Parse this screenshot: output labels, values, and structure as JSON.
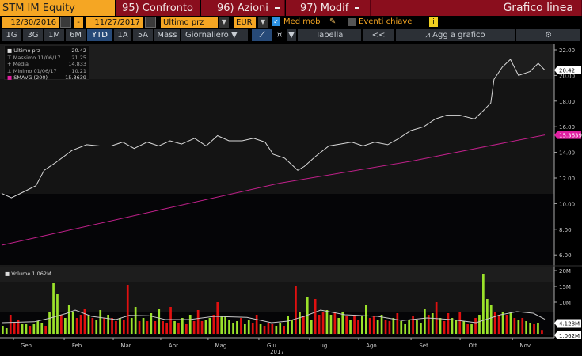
{
  "header": {
    "title": "STM IM Equity",
    "btn_compare": "95) Confronto",
    "btn_actions": "96) Azioni",
    "btn_edit": "97) Modif",
    "chart_type": "Grafico linea"
  },
  "controls": {
    "start_date": "12/30/2016",
    "date_sep": "-",
    "end_date": "11/27/2017",
    "price_field": "Ultimo prz",
    "currency": "EUR",
    "moving_avg_label": "Med mob",
    "key_events_label": "Eventi chiave",
    "info": "i"
  },
  "periods": [
    "1G",
    "3G",
    "1M",
    "6M",
    "YTD",
    "1A",
    "5A",
    "Mass"
  ],
  "frequency": "Giornaliero",
  "toolbar": {
    "table": "Tabella",
    "collapse": "<<",
    "add_to_chart": "Agg a grafico"
  },
  "legend": {
    "last": {
      "label": "Ultimo prz",
      "value": "20.42"
    },
    "high": {
      "label": "Massimo 11/06/17",
      "value": "21.25"
    },
    "avg": {
      "label": "Media",
      "value": "14.833"
    },
    "low": {
      "label": "Minimo 01/06/17",
      "value": "10.21"
    },
    "smavg": {
      "label": "SMAVG (200)",
      "value": "15.3639"
    },
    "volume": "Volume 1.062M"
  },
  "colors": {
    "price": "#d8d8d8",
    "smavg": "#c0208a",
    "up": "#9be22a",
    "down": "#e01010",
    "accent": "#f5a623",
    "header_red": "#8a0e1d"
  },
  "chart_data": [
    {
      "type": "line",
      "title": "STM IM Equity",
      "x_unit": "days since 12/30/2016",
      "xlim": [
        0,
        332
      ],
      "ylim": [
        5.5,
        22.5
      ],
      "yticks": [
        "22.00",
        "20.00",
        "18.00",
        "16.00",
        "14.00",
        "12.00",
        "10.00",
        "8.00",
        "6.00"
      ],
      "series": [
        {
          "name": "Ultimo prz",
          "points": [
            [
              0,
              10.8
            ],
            [
              6,
              10.45
            ],
            [
              14,
              10.95
            ],
            [
              21,
              11.4
            ],
            [
              26,
              12.6
            ],
            [
              33,
              13.2
            ],
            [
              43,
              14.15
            ],
            [
              52,
              14.6
            ],
            [
              60,
              14.5
            ],
            [
              67,
              14.5
            ],
            [
              74,
              14.8
            ],
            [
              81,
              14.3
            ],
            [
              89,
              14.8
            ],
            [
              96,
              14.5
            ],
            [
              103,
              14.9
            ],
            [
              110,
              14.65
            ],
            [
              118,
              15.1
            ],
            [
              125,
              14.5
            ],
            [
              132,
              15.3
            ],
            [
              139,
              14.9
            ],
            [
              147,
              14.9
            ],
            [
              154,
              15.1
            ],
            [
              161,
              14.8
            ],
            [
              166,
              13.85
            ],
            [
              173,
              13.55
            ],
            [
              181,
              12.6
            ],
            [
              185,
              12.9
            ],
            [
              192,
              13.7
            ],
            [
              200,
              14.5
            ],
            [
              207,
              14.65
            ],
            [
              214,
              14.8
            ],
            [
              221,
              14.5
            ],
            [
              228,
              14.8
            ],
            [
              236,
              14.6
            ],
            [
              243,
              15.1
            ],
            [
              250,
              15.7
            ],
            [
              258,
              16
            ],
            [
              265,
              16.6
            ],
            [
              272,
              16.9
            ],
            [
              280,
              16.9
            ],
            [
              289,
              16.6
            ],
            [
              294,
              17.2
            ],
            [
              299,
              17.85
            ],
            [
              301,
              19.7
            ],
            [
              306,
              20.65
            ],
            [
              311,
              21.25
            ],
            [
              316,
              20.0
            ],
            [
              323,
              20.3
            ],
            [
              328,
              20.95
            ],
            [
              332,
              20.42
            ]
          ],
          "last_tag": "20.42"
        },
        {
          "name": "SMAVG (200)",
          "points": [
            [
              0,
              6.75
            ],
            [
              100,
              9.6
            ],
            [
              170,
              11.6
            ],
            [
              250,
              13.3
            ],
            [
              332,
              15.36
            ]
          ],
          "last_tag": "15.3639"
        }
      ]
    },
    {
      "type": "bar",
      "title": "Volume",
      "unit": "M",
      "note": "negative = down day (red), positive = up day (green)",
      "ylim": [
        0,
        20
      ],
      "yticks": [
        "20M",
        "15M",
        "10M"
      ],
      "values": [
        2.5,
        2,
        -6,
        -3.5,
        -4.5,
        3,
        3,
        -2.5,
        3,
        4,
        3.5,
        -2.5,
        7,
        16,
        12.5,
        -6,
        5,
        9,
        7,
        -5,
        -6,
        -8,
        6,
        -5,
        4.5,
        7.5,
        -5,
        6,
        -5,
        -4,
        5,
        -4.5,
        -15.5,
        5,
        8.5,
        -4,
        5,
        -4,
        6.5,
        -4,
        8,
        -4,
        -3.5,
        -8.5,
        4,
        -3.5,
        5,
        -3,
        6,
        -4,
        -7.5,
        -4,
        4.5,
        5,
        -6,
        -10,
        5.5,
        5.5,
        4.5,
        3.5,
        4,
        -5,
        3,
        4.5,
        -3.5,
        -6,
        3,
        -2.5,
        -3.5,
        -3,
        2.5,
        3.5,
        -2.5,
        5.5,
        4.5,
        -15,
        7,
        -5.5,
        11.5,
        4.5,
        -11,
        -6,
        -7,
        7.5,
        6,
        -7,
        5,
        7,
        -5.5,
        4.5,
        -6,
        -4.5,
        5.5,
        9,
        -5,
        -5.5,
        4.5,
        6,
        -4.5,
        -4,
        5,
        -6.5,
        4,
        3,
        4.5,
        -5.5,
        4.5,
        3.5,
        8,
        -6,
        6.5,
        -10,
        5,
        -4,
        -6.5,
        5,
        4.5,
        -7,
        4,
        -3,
        3,
        -5,
        6,
        19,
        11,
        9,
        -7,
        -6,
        7,
        -6,
        7,
        -5,
        4.5,
        -5,
        4,
        3.5,
        -3,
        3.5,
        -1.2
      ],
      "moving_avg": [
        [
          0,
          3.5
        ],
        [
          20,
          3.8
        ],
        [
          30,
          5
        ],
        [
          40,
          6.5
        ],
        [
          45,
          7.5
        ],
        [
          55,
          5.5
        ],
        [
          70,
          4.5
        ],
        [
          78,
          5.8
        ],
        [
          90,
          5.7
        ],
        [
          100,
          4.5
        ],
        [
          115,
          4.5
        ],
        [
          130,
          5.5
        ],
        [
          150,
          5.2
        ],
        [
          165,
          3.5
        ],
        [
          175,
          4
        ],
        [
          185,
          5.5
        ],
        [
          195,
          7.5
        ],
        [
          210,
          6
        ],
        [
          230,
          5.5
        ],
        [
          245,
          4.2
        ],
        [
          260,
          5
        ],
        [
          275,
          4.5
        ],
        [
          290,
          3.5
        ],
        [
          305,
          6
        ],
        [
          315,
          7
        ],
        [
          325,
          6.5
        ],
        [
          332,
          4.6
        ]
      ],
      "tags": [
        "4.128M",
        "1.062M"
      ]
    }
  ],
  "x_axis": {
    "months": [
      {
        "label": "Gen",
        "day": 15
      },
      {
        "label": "Feb",
        "day": 46
      },
      {
        "label": "Mar",
        "day": 76
      },
      {
        "label": "Apr",
        "day": 105
      },
      {
        "label": "Mag",
        "day": 134
      },
      {
        "label": "Giu",
        "day": 165
      },
      {
        "label": "Lug",
        "day": 196
      },
      {
        "label": "Ago",
        "day": 226
      },
      {
        "label": "Set",
        "day": 258
      },
      {
        "label": "Ott",
        "day": 288
      },
      {
        "label": "Nov",
        "day": 320
      }
    ],
    "year": "2017"
  }
}
